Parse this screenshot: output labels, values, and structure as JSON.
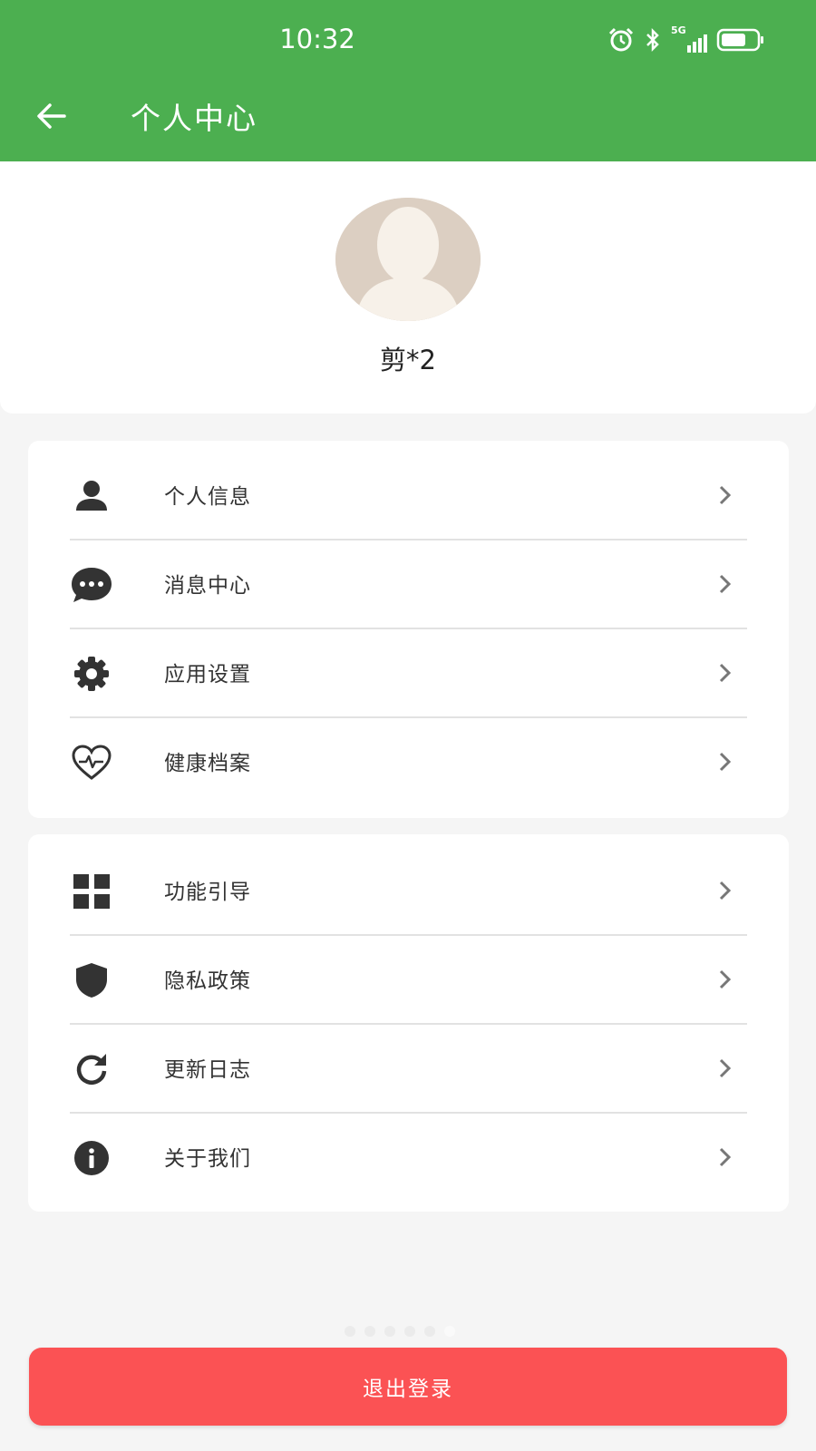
{
  "status_bar": {
    "time": "10:32",
    "network": "5G",
    "icons": [
      "alarm-icon",
      "bluetooth-icon",
      "signal-icon",
      "battery-icon"
    ]
  },
  "toolbar": {
    "back_icon": "arrow-left-icon",
    "title": "个人中心"
  },
  "profile": {
    "avatar_icon": "default-avatar-icon",
    "username": "剪*2"
  },
  "menu_group_1": [
    {
      "label": "个人信息",
      "icon": "person-icon"
    },
    {
      "label": "消息中心",
      "icon": "chat-bubble-icon"
    },
    {
      "label": "应用设置",
      "icon": "gear-icon"
    },
    {
      "label": "健康档案",
      "icon": "heart-pulse-icon"
    }
  ],
  "menu_group_2": [
    {
      "label": "功能引导",
      "icon": "grid-icon"
    },
    {
      "label": "隐私政策",
      "icon": "shield-icon"
    },
    {
      "label": "更新日志",
      "icon": "refresh-icon"
    },
    {
      "label": "关于我们",
      "icon": "info-icon"
    }
  ],
  "logout_button": {
    "label": "退出登录"
  },
  "colors": {
    "header": "#4caf50",
    "logout": "#fb5254",
    "background": "#f5f5f5",
    "icon": "#333333",
    "chevron": "#777777"
  }
}
